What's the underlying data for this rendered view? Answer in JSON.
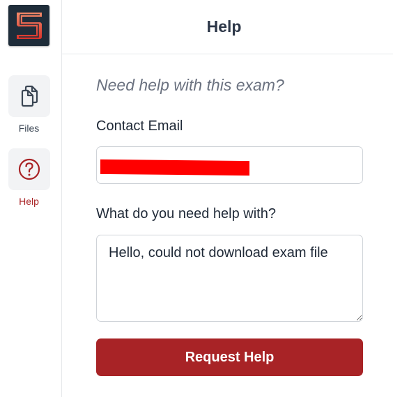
{
  "sidebar": {
    "logo_icon": "brand-logo-s",
    "items": [
      {
        "label": "Files",
        "icon": "files-icon",
        "color": "#3b4654"
      },
      {
        "label": "Help",
        "icon": "help-circle-icon",
        "color": "#a92326",
        "active": true
      }
    ]
  },
  "header": {
    "title": "Help"
  },
  "form": {
    "subtitle": "Need help with this exam?",
    "email_label": "Contact Email",
    "email_value": "",
    "help_label": "What do you need help with?",
    "help_value": "Hello, could not download exam file",
    "submit_label": "Request Help"
  },
  "colors": {
    "accent": "#a82326",
    "logo_bg": "#1f2d3a",
    "redaction": "#ff0000"
  }
}
